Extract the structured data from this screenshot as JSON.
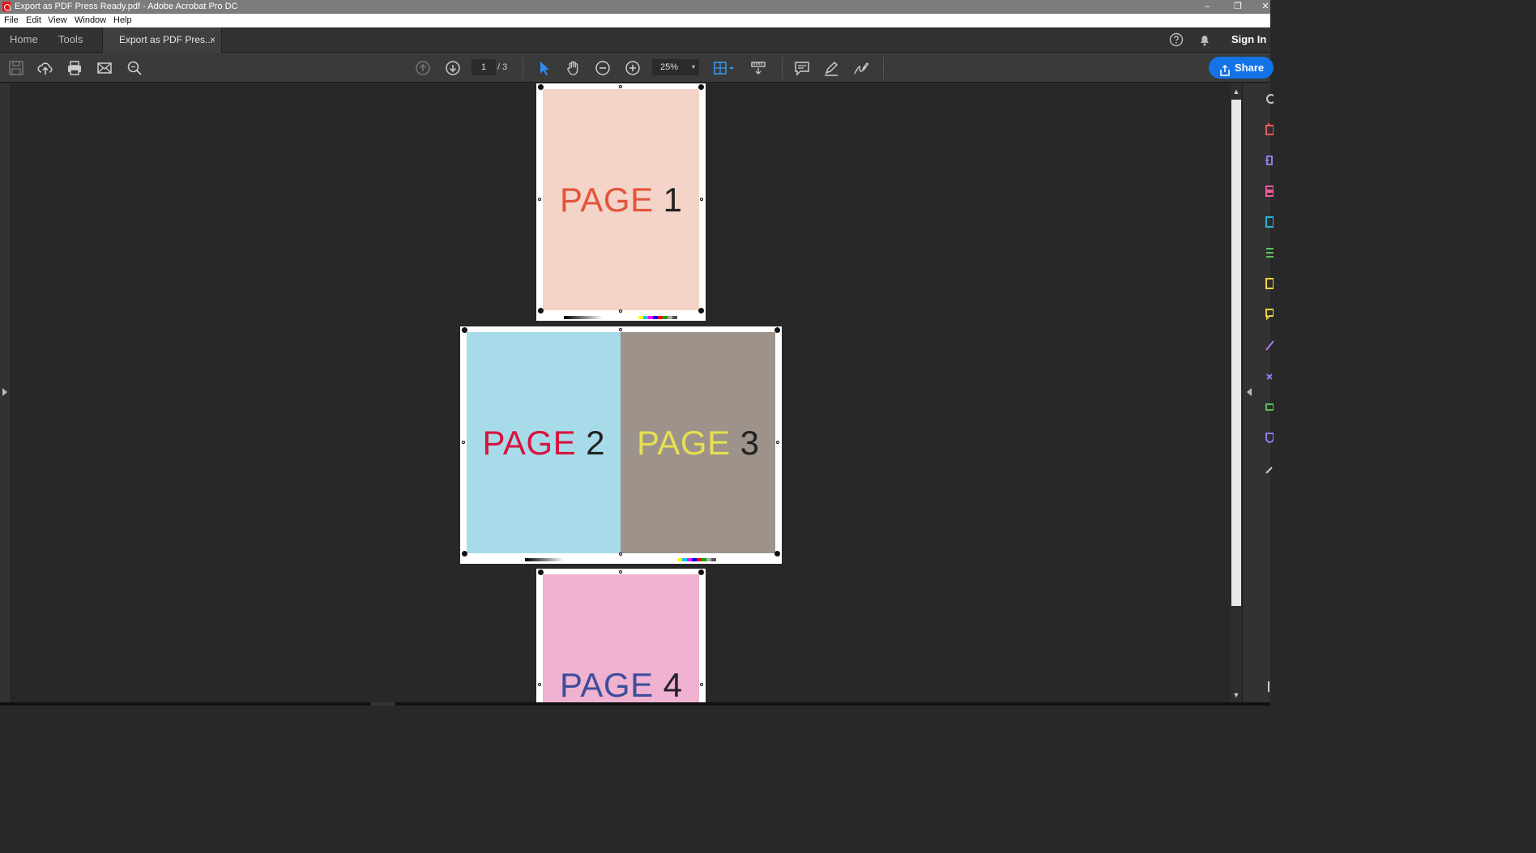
{
  "window": {
    "title": "Export as PDF Press Ready.pdf - Adobe Acrobat Pro DC",
    "controls": {
      "minimize": "–",
      "restore": "❐",
      "close": "✕"
    }
  },
  "menu": [
    "File",
    "Edit",
    "View",
    "Window",
    "Help"
  ],
  "tabs": {
    "home": "Home",
    "tools": "Tools",
    "document": "Export as PDF Pres...",
    "close": "×",
    "sign_in": "Sign In"
  },
  "toolbar": {
    "current_page": "1",
    "page_total": "/ 3",
    "zoom": "25%",
    "zoom_caret": "▾",
    "share_label": "Share"
  },
  "scrollbar": {
    "up": "▲",
    "down": "▼"
  },
  "pages": [
    {
      "word": "PAGE",
      "number": "1",
      "bg": "#f4d3c8",
      "word_color": "#e2553c"
    },
    {
      "word": "PAGE",
      "number": "2",
      "bg": "#a7dbe9",
      "word_color": "#d7143f"
    },
    {
      "word": "PAGE",
      "number": "3",
      "bg": "#9d938a",
      "word_color": "#e6df52"
    },
    {
      "word": "PAGE",
      "number": "4",
      "bg": "#efb2d0",
      "word_color": "#3c4e9c"
    }
  ],
  "colors": {
    "accent": "#1473e6",
    "app_background": "#282828",
    "toolbar": "#3a3a3a"
  }
}
